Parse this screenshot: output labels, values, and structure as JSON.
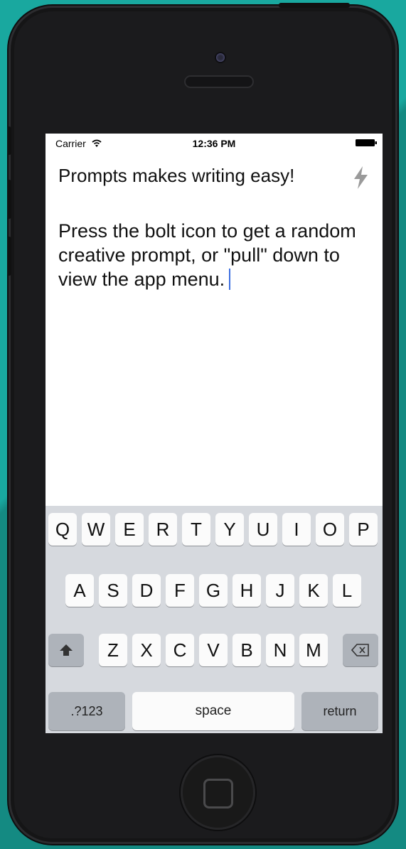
{
  "status_bar": {
    "carrier": "Carrier",
    "time": "12:36 PM",
    "icons": [
      "wifi-icon",
      "battery-icon"
    ]
  },
  "editor": {
    "title": "Prompts makes writing easy!",
    "body": "Press the bolt icon to get a random creative prompt, or \"pull\" down to view the app menu.",
    "action_icon": "bolt-icon"
  },
  "keyboard": {
    "row1": [
      "Q",
      "W",
      "E",
      "R",
      "T",
      "Y",
      "U",
      "I",
      "O",
      "P"
    ],
    "row2": [
      "A",
      "S",
      "D",
      "F",
      "G",
      "H",
      "J",
      "K",
      "L"
    ],
    "row3": [
      "Z",
      "X",
      "C",
      "V",
      "B",
      "N",
      "M"
    ],
    "shift_icon": "shift-arrow-icon",
    "delete_icon": "delete-icon",
    "numbers_label": ".?123",
    "space_label": "space",
    "return_label": "return"
  },
  "colors": {
    "background": "#19a89f",
    "phone_body": "#1b1b1d",
    "cursor": "#3d6fe0",
    "keyboard_bg": "#d6d9de"
  }
}
